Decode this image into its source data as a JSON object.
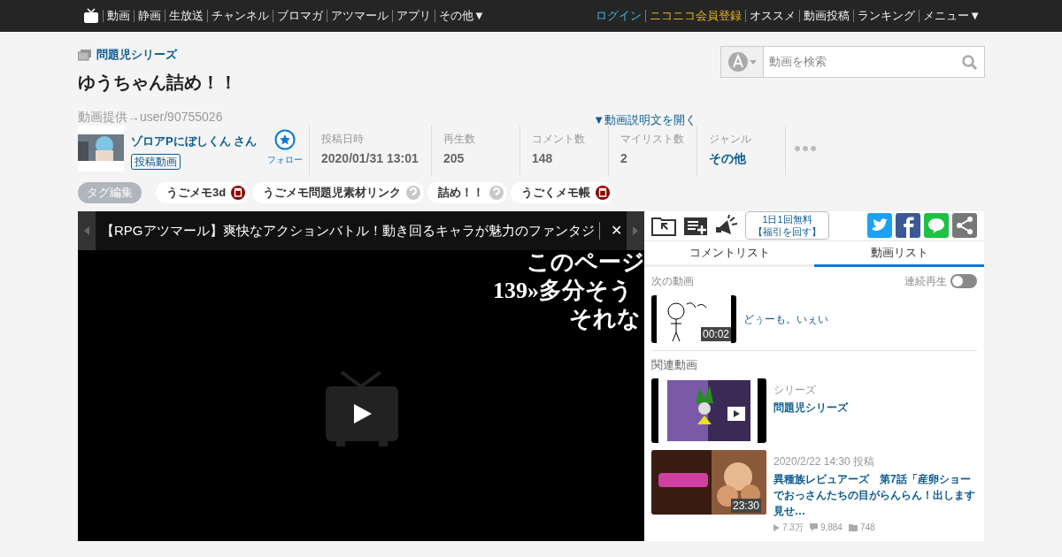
{
  "top_nav": {
    "left": [
      "動画",
      "静画",
      "生放送",
      "チャンネル",
      "ブロマガ",
      "アツマール",
      "アプリ",
      "その他▼"
    ],
    "right": [
      {
        "label": "ログイン",
        "kind": "login"
      },
      {
        "label": "ニコニコ会員登録",
        "kind": "register"
      },
      {
        "label": "オススメ",
        "kind": "plain"
      },
      {
        "label": "動画投稿",
        "kind": "plain"
      },
      {
        "label": "ランキング",
        "kind": "plain"
      },
      {
        "label": "メニュー▼",
        "kind": "plain"
      }
    ]
  },
  "series": "問題児シリーズ",
  "title": "ゆうちゃん詰め！！",
  "provider": "動画提供→user/90755026",
  "description_toggle": "▼動画説明文を開く",
  "search": {
    "placeholder": "動画を検索"
  },
  "uploader": {
    "name": "ゾロアPにぼしくん さん",
    "badge": "投稿動画",
    "follow": "フォロー"
  },
  "stats": [
    {
      "label": "投稿日時",
      "value": "2020/01/31 13:01",
      "link": false
    },
    {
      "label": "再生数",
      "value": "205",
      "link": false
    },
    {
      "label": "コメント数",
      "value": "148",
      "link": false
    },
    {
      "label": "マイリスト数",
      "value": "2",
      "link": false
    },
    {
      "label": "ジャンル",
      "value": "その他",
      "link": true
    }
  ],
  "tag_edit": "タグ編集",
  "tags": [
    {
      "label": "うごメモ3d",
      "kind": "dic"
    },
    {
      "label": "うごメモ問題児素材リンク",
      "kind": "nodic"
    },
    {
      "label": "詰め！！",
      "kind": "nodic"
    },
    {
      "label": "うごくメモ帳",
      "kind": "dic"
    }
  ],
  "player": {
    "ad": "【RPGアツマール】爽快なアクションバトル！動き回るキャラが魅力のファンタジ",
    "close": "✕",
    "comments": [
      "このページ",
      "139»多分そう",
      "それな"
    ]
  },
  "panel": {
    "fukubiki": [
      "1日1回無料",
      "【福引を回す】"
    ],
    "tabs": [
      {
        "label": "コメントリスト",
        "selected": false
      },
      {
        "label": "動画リスト",
        "selected": true
      }
    ],
    "next_label": "次の動画",
    "autoplay": {
      "label": "連続再生",
      "on": false
    },
    "next_video": {
      "title": "どぅーも。いぇい",
      "duration": "00:02"
    },
    "related_label": "関連動画",
    "related": [
      {
        "kind": "series",
        "meta": "シリーズ",
        "title": "問題児シリーズ"
      },
      {
        "kind": "video",
        "meta": "2020/2/22 14:30 投稿",
        "title": "異種族レビュアーズ　第7話「産卵ショーでおっさんたちの目がらんらん！出します見せ…",
        "duration": "23:30",
        "views": "7.3万",
        "comments": "9,884",
        "mylists": "748"
      }
    ]
  }
}
